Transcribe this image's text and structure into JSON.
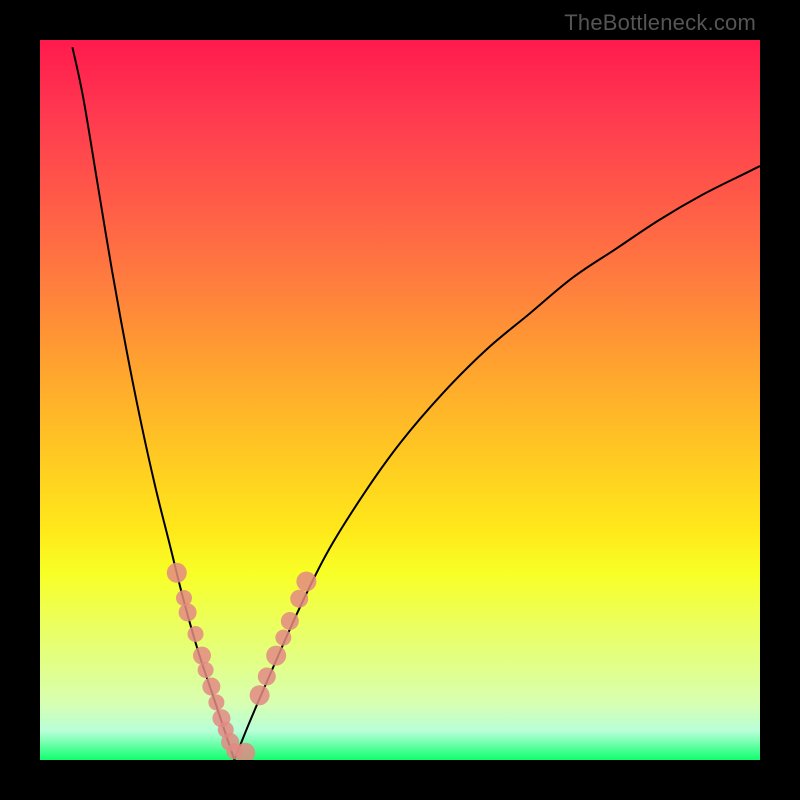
{
  "watermark": "TheBottleneck.com",
  "chart_data": {
    "type": "line",
    "title": "",
    "xlabel": "",
    "ylabel": "",
    "xlim": [
      0,
      100
    ],
    "ylim": [
      0,
      100
    ],
    "bottleneck_x": 27,
    "curves": {
      "left": {
        "x": [
          4.5,
          6,
          8,
          10,
          12,
          14,
          16,
          18,
          20,
          22,
          24,
          26,
          27
        ],
        "y": [
          99,
          92,
          80,
          68,
          57,
          47,
          38,
          30,
          22,
          15,
          9,
          3,
          0
        ]
      },
      "right": {
        "x": [
          27,
          29,
          32,
          36,
          40,
          45,
          50,
          56,
          62,
          68,
          74,
          80,
          86,
          92,
          98,
          100
        ],
        "y": [
          0,
          5,
          12,
          21,
          29,
          37,
          44,
          51,
          57,
          62,
          67,
          71,
          75,
          78.5,
          81.5,
          82.5
        ]
      }
    },
    "series": [
      {
        "name": "markers-left-branch",
        "x": [
          19,
          20,
          20.5,
          21.6,
          22.5,
          23,
          23.8,
          24.5,
          25.2,
          25.8,
          26.4,
          27,
          28.5
        ],
        "y": [
          26,
          22.5,
          20.5,
          17.5,
          14.5,
          12.5,
          10.2,
          8.0,
          5.8,
          4.2,
          2.5,
          1.2,
          1.0
        ],
        "r": [
          10,
          8,
          9,
          8,
          9,
          8,
          9,
          8,
          9,
          8,
          9,
          8,
          10
        ]
      },
      {
        "name": "markers-right-branch",
        "x": [
          30.5,
          31.5,
          32.8,
          33.8,
          34.7,
          36.0,
          37.0
        ],
        "y": [
          9.0,
          11.6,
          14.5,
          17.0,
          19.3,
          22.4,
          24.8
        ],
        "r": [
          10,
          9,
          10,
          8,
          9,
          9,
          10
        ]
      }
    ],
    "grid": false,
    "legend": false
  }
}
